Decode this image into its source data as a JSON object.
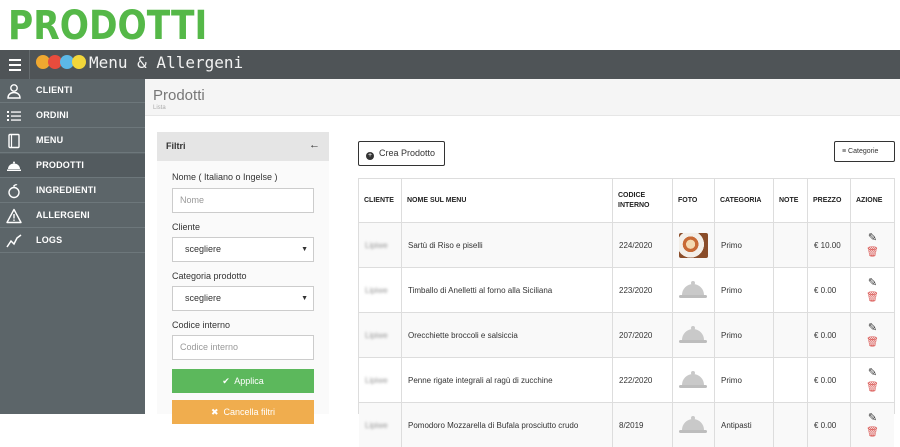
{
  "banner": {
    "title": "PRODOTTI"
  },
  "app": {
    "title": "Menu & Allergeni",
    "logo_colors": [
      "#f0a830",
      "#e84c3d",
      "#5cb8e6",
      "#f2d63a"
    ]
  },
  "sidebar": {
    "items": [
      {
        "label": "CLIENTI",
        "icon": "user-icon"
      },
      {
        "label": "ORDINI",
        "icon": "list-icon"
      },
      {
        "label": "MENU",
        "icon": "book-icon"
      },
      {
        "label": "PRODOTTI",
        "icon": "cloche-icon",
        "active": true
      },
      {
        "label": "INGREDIENTI",
        "icon": "apple-icon"
      },
      {
        "label": "ALLERGENI",
        "icon": "warning-icon"
      },
      {
        "label": "LOGS",
        "icon": "chart-line-icon"
      }
    ]
  },
  "page": {
    "title": "Prodotti",
    "subtitle": "Lista"
  },
  "filters": {
    "title": "Filtri",
    "name_label": "Nome ( Italiano o Ingelse )",
    "name_placeholder": "Nome",
    "client_label": "Cliente",
    "client_value": "scegliere",
    "category_label": "Categoria prodotto",
    "category_value": "scegliere",
    "code_label": "Codice interno",
    "code_placeholder": "Codice interno",
    "apply_label": "Applica",
    "cancel_label": "Cancella filtri"
  },
  "toolbar": {
    "create_label": "Crea Prodotto",
    "categories_label": "Categorie"
  },
  "table": {
    "headers": [
      "CLIENTE",
      "NOME SUL MENU",
      "CODICE INTERNO",
      "FOTO",
      "CATEGORIA",
      "NOTE",
      "PREZZO",
      "AZIONE"
    ],
    "rows": [
      {
        "client": "Lipiwe",
        "name": "Sartù di Riso e piselli",
        "code": "224/2020",
        "photo": "photo",
        "category": "Primo",
        "note": "",
        "price": "€ 10.00"
      },
      {
        "client": "Lipiwe",
        "name": "Timballo di Anelletti al forno alla Siciliana",
        "code": "223/2020",
        "photo": "placeholder",
        "category": "Primo",
        "note": "",
        "price": "€ 0.00"
      },
      {
        "client": "Lipiwe",
        "name": "Orecchiette broccoli e salsiccia",
        "code": "207/2020",
        "photo": "placeholder",
        "category": "Primo",
        "note": "",
        "price": "€ 0.00"
      },
      {
        "client": "Lipiwe",
        "name": "Penne rigate integrali al ragù di zucchine",
        "code": "222/2020",
        "photo": "placeholder",
        "category": "Primo",
        "note": "",
        "price": "€ 0.00"
      },
      {
        "client": "Lipiwe",
        "name": "Pomodoro Mozzarella di Bufala prosciutto crudo",
        "code": "8/2019",
        "photo": "placeholder",
        "category": "Antipasti",
        "note": "",
        "price": "€ 0.00"
      }
    ]
  }
}
